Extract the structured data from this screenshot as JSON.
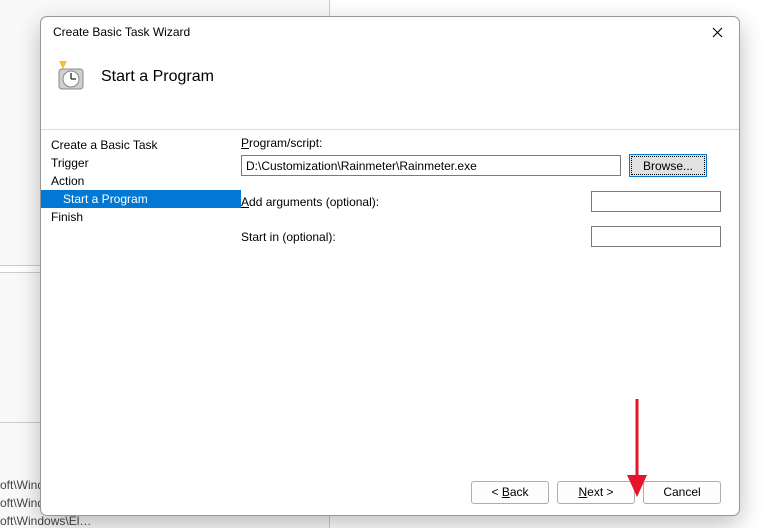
{
  "background": {
    "item1": "oft\\Wind…",
    "item2": "oft\\Windows\\U…",
    "item3": "oft\\Windows\\El…"
  },
  "dialog": {
    "title": "Create Basic Task Wizard",
    "header": "Start a Program",
    "sidebar": {
      "items": [
        {
          "label": "Create a Basic Task",
          "indent": false,
          "selected": false
        },
        {
          "label": "Trigger",
          "indent": false,
          "selected": false
        },
        {
          "label": "Action",
          "indent": false,
          "selected": false
        },
        {
          "label": "Start a Program",
          "indent": true,
          "selected": true
        },
        {
          "label": "Finish",
          "indent": false,
          "selected": false
        }
      ]
    },
    "form": {
      "program_label_pre": "P",
      "program_label_post": "rogram/script:",
      "program_value": "D:\\Customization\\Rainmeter\\Rainmeter.exe",
      "browse_pre": "B",
      "browse_post": "rowse...",
      "args_label_pre": "A",
      "args_label_post": "dd arguments (optional):",
      "args_value": "",
      "startin_label": "Start in (optional):",
      "startin_value": ""
    },
    "footer": {
      "back_pre": "< ",
      "back_accel": "B",
      "back_post": "ack",
      "next_accel": "N",
      "next_post": "ext >",
      "cancel": "Cancel"
    }
  }
}
